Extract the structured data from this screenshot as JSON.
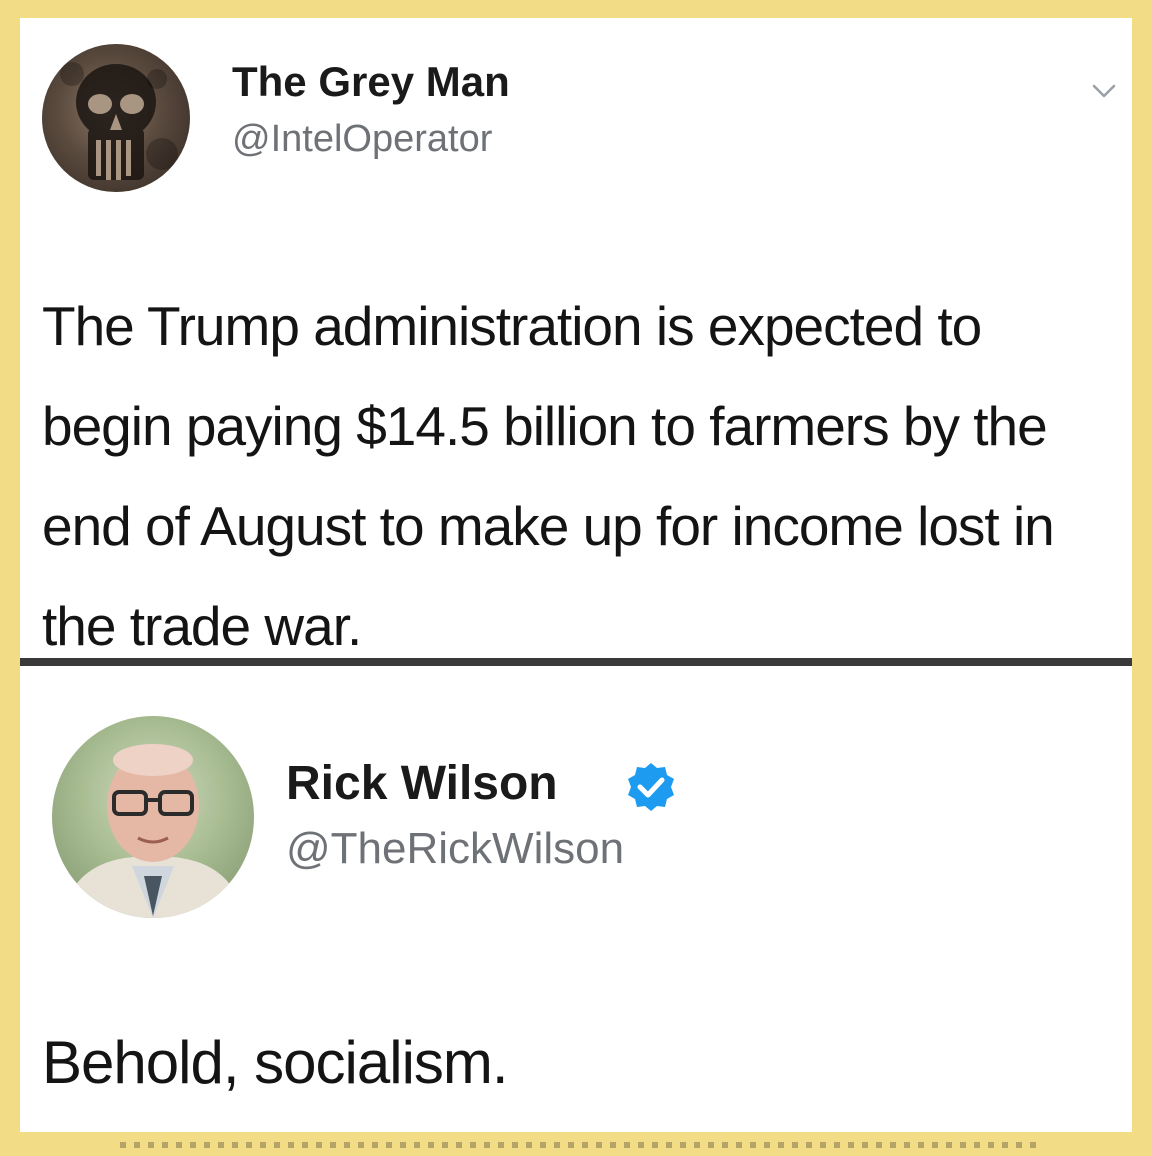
{
  "tweets": [
    {
      "name": "The Grey Man",
      "handle": "@IntelOperator",
      "text": "The Trump administration is expected to begin paying $14.5 billion to farmers by the end of August to make up for income lost in the trade war.",
      "avatar_icon": "skull-avatar",
      "menu_icon": "chevron-down-icon"
    },
    {
      "name": "Rick Wilson",
      "handle": "@TheRickWilson",
      "text": "Behold, socialism.",
      "avatar_icon": "person-avatar",
      "verified_icon": "verified-badge-icon"
    }
  ],
  "colors": {
    "border": "#f2dd86",
    "verified": "#1d9bf0",
    "handle": "#6e7277",
    "divider": "#3a3a3a"
  }
}
